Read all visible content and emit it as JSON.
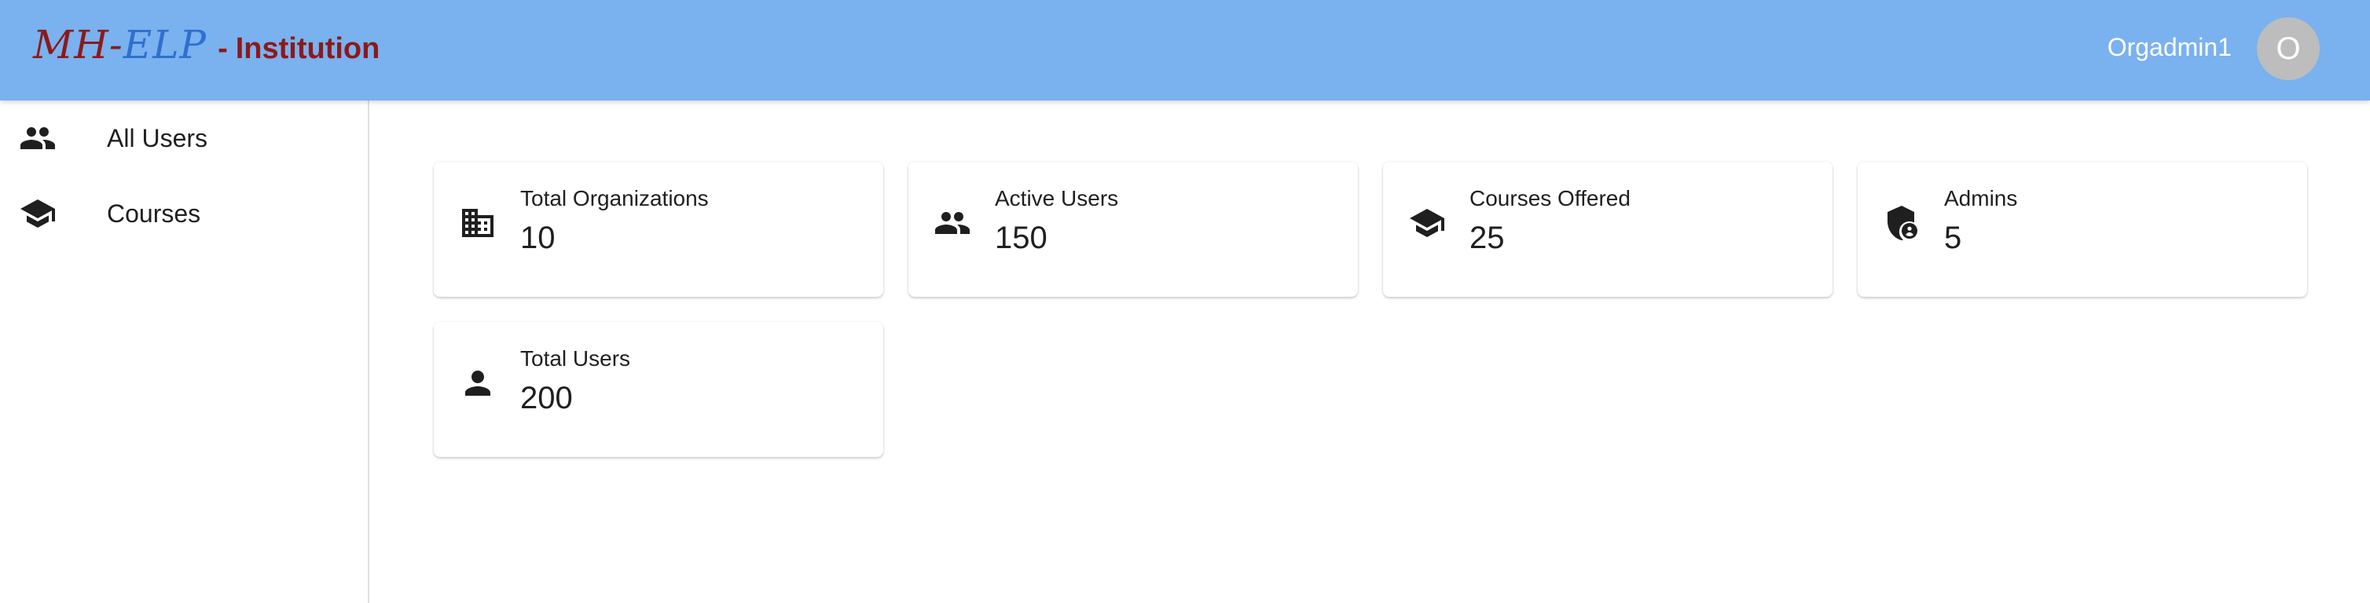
{
  "header": {
    "brand_mh": "MH",
    "brand_dash": "-",
    "brand_elp": "ELP",
    "brand_sep": "-",
    "brand_sub": "Institution",
    "user_name": "Orgadmin1",
    "avatar_initial": "O",
    "background_color": "#7ab1ef"
  },
  "sidebar": {
    "items": [
      {
        "label": "All Users",
        "icon": "people-icon"
      },
      {
        "label": "Courses",
        "icon": "school-icon"
      }
    ]
  },
  "cards": [
    {
      "title": "Total Organizations",
      "value": "10",
      "icon": "building-icon"
    },
    {
      "title": "Active Users",
      "value": "150",
      "icon": "people-icon"
    },
    {
      "title": "Courses Offered",
      "value": "25",
      "icon": "school-icon"
    },
    {
      "title": "Admins",
      "value": "5",
      "icon": "admin-shield-icon"
    },
    {
      "title": "Total Users",
      "value": "200",
      "icon": "person-icon"
    }
  ]
}
